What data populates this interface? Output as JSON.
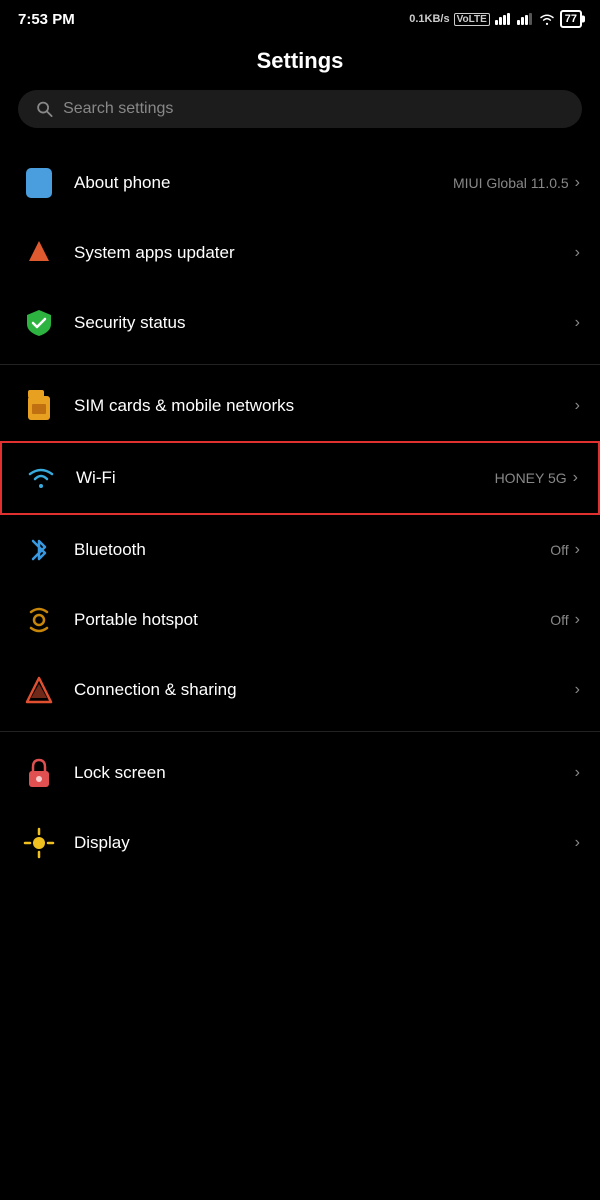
{
  "statusBar": {
    "time": "7:53 PM",
    "speed": "0.1KB/s",
    "networkType": "VoLTE",
    "battery": "77"
  },
  "page": {
    "title": "Settings"
  },
  "search": {
    "placeholder": "Search settings"
  },
  "items": [
    {
      "id": "about-phone",
      "label": "About phone",
      "value": "MIUI Global 11.0.5",
      "iconType": "phone",
      "interactable": true
    },
    {
      "id": "system-apps-updater",
      "label": "System apps updater",
      "value": "",
      "iconType": "arrow-up",
      "interactable": true
    },
    {
      "id": "security-status",
      "label": "Security status",
      "value": "",
      "iconType": "shield",
      "interactable": true
    },
    {
      "id": "sim-cards",
      "label": "SIM cards & mobile networks",
      "value": "",
      "iconType": "sim",
      "interactable": true
    },
    {
      "id": "wifi",
      "label": "Wi-Fi",
      "value": "HONEY 5G",
      "iconType": "wifi",
      "interactable": true,
      "highlighted": true
    },
    {
      "id": "bluetooth",
      "label": "Bluetooth",
      "value": "Off",
      "iconType": "bluetooth",
      "interactable": true
    },
    {
      "id": "portable-hotspot",
      "label": "Portable hotspot",
      "value": "Off",
      "iconType": "hotspot",
      "interactable": true
    },
    {
      "id": "connection-sharing",
      "label": "Connection & sharing",
      "value": "",
      "iconType": "connection",
      "interactable": true
    },
    {
      "id": "lock-screen",
      "label": "Lock screen",
      "value": "",
      "iconType": "lock",
      "interactable": true
    },
    {
      "id": "display",
      "label": "Display",
      "value": "",
      "iconType": "display",
      "interactable": true
    }
  ],
  "dividers": [
    2,
    3,
    7,
    8
  ]
}
